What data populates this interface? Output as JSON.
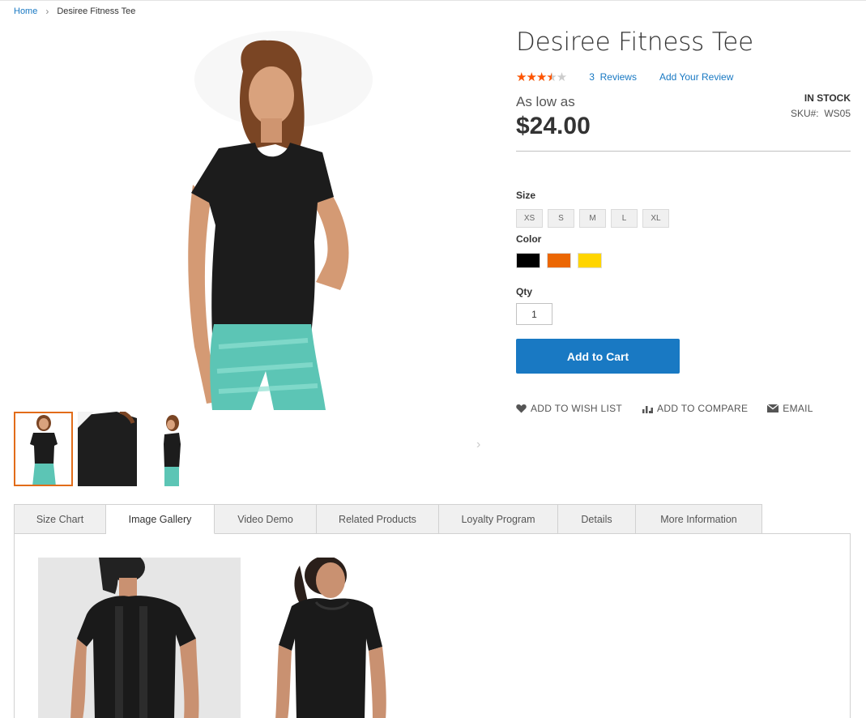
{
  "breadcrumb": {
    "home": "Home",
    "current": "Desiree Fitness Tee"
  },
  "product": {
    "title": "Desiree Fitness Tee",
    "rating": 0.7,
    "reviews_count": "3",
    "reviews_label": "Reviews",
    "add_review": "Add Your Review",
    "price_prefix": "As low as",
    "price": "$24.00",
    "stock": "IN STOCK",
    "sku_label": "SKU#:",
    "sku": "WS05"
  },
  "options": {
    "size_label": "Size",
    "sizes": [
      "XS",
      "S",
      "M",
      "L",
      "XL"
    ],
    "color_label": "Color",
    "colors": [
      "#000000",
      "#eb6703",
      "#ffd500"
    ],
    "qty_label": "Qty",
    "qty": "1"
  },
  "add_to_cart": "Add to Cart",
  "actions": {
    "wishlist": "ADD TO WISH LIST",
    "compare": "ADD TO COMPARE",
    "email": "EMAIL"
  },
  "tabs": [
    "Size Chart",
    "Image Gallery",
    "Video Demo",
    "Related Products",
    "Loyalty Program",
    "Details",
    "More Information"
  ],
  "active_tab": "Image Gallery",
  "theme": {
    "accent": "#1979c3",
    "star": "#ff5501",
    "thumb_active": "#e26c19",
    "shirt": "#1c1c1c",
    "pants": "#5cc5b5"
  }
}
